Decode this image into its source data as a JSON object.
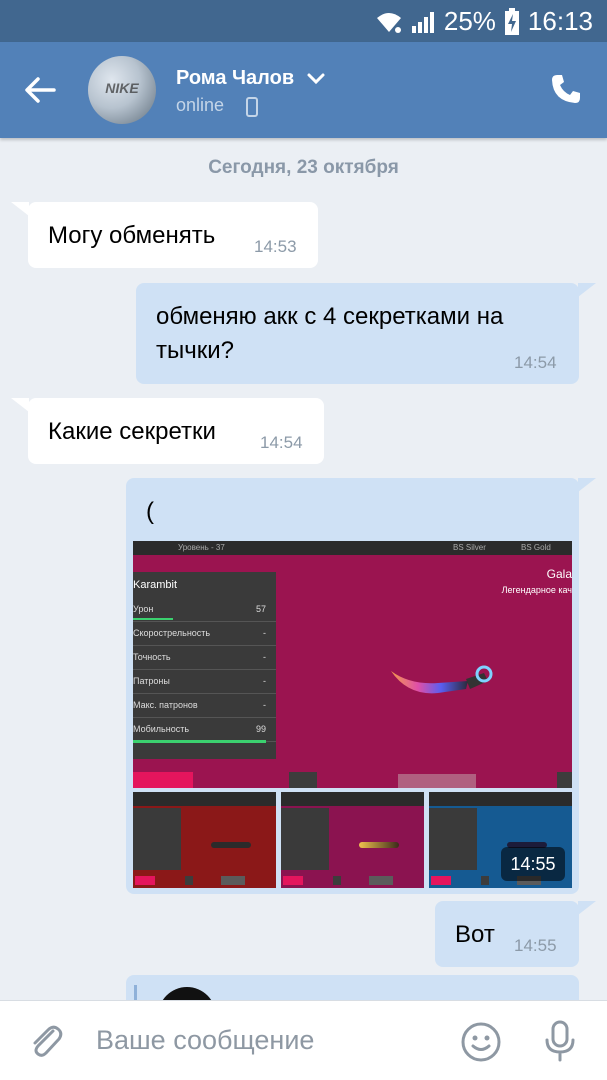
{
  "status_bar": {
    "battery": "25%",
    "time": "16:13"
  },
  "header": {
    "contact_name": "Рома Чалов",
    "status": "online",
    "avatar_logo": "NIKE"
  },
  "chat": {
    "date": "Сегодня, 23 октября",
    "messages": [
      {
        "direction": "in",
        "text": "Могу обменять",
        "time": "14:53"
      },
      {
        "direction": "out",
        "text_line1": "обменяю акк с 4 секретками на",
        "text_line2": "тычки?",
        "time": "14:54"
      },
      {
        "direction": "in",
        "text": "Какие секретки",
        "time": "14:54"
      },
      {
        "direction": "out",
        "text": "(",
        "time": "14:55"
      },
      {
        "direction": "out",
        "text": "Вот",
        "time": "14:55"
      }
    ]
  },
  "screenshot_content": {
    "level": "Уровень - 37",
    "tier1": "BS Silver",
    "tier2": "BS Gold",
    "weapon": "Karambit",
    "right_title": "Gala",
    "right_subtitle": "Легендарное кач",
    "stats": [
      {
        "name": "Урон",
        "value": "57"
      },
      {
        "name": "Скорострельность",
        "value": "-"
      },
      {
        "name": "Точность",
        "value": "-"
      },
      {
        "name": "Патроны",
        "value": "-"
      },
      {
        "name": "Макс. патронов",
        "value": "-"
      },
      {
        "name": "Мобильность",
        "value": "99"
      }
    ]
  },
  "input": {
    "placeholder": "Ваше сообщение"
  },
  "colors": {
    "header": "#5281b8",
    "status_bar": "#41678f",
    "bubble_out": "#cfe1f5",
    "bubble_in": "#ffffff",
    "background": "#ebeff4"
  }
}
